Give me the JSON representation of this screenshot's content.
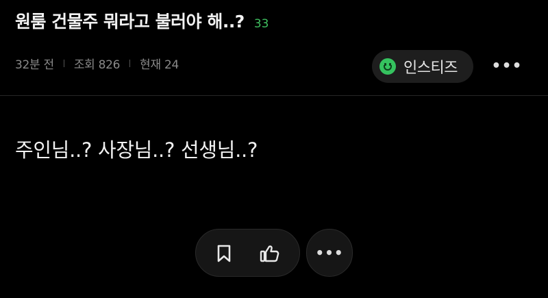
{
  "post": {
    "title": "원룸 건물주 뭐라고 불러야 해..?",
    "comment_count": "33",
    "time_ago": "32분 전",
    "views": "조회 826",
    "current": "현재 24",
    "body": "주인님..? 사장님..? 선생님..?"
  },
  "channel": {
    "name": "인스티즈",
    "icon": "smile-icon",
    "accent": "#35c25f"
  },
  "actions": {
    "more_label": "•••",
    "bookmark_icon": "bookmark-icon",
    "like_icon": "thumbs-up-icon"
  }
}
